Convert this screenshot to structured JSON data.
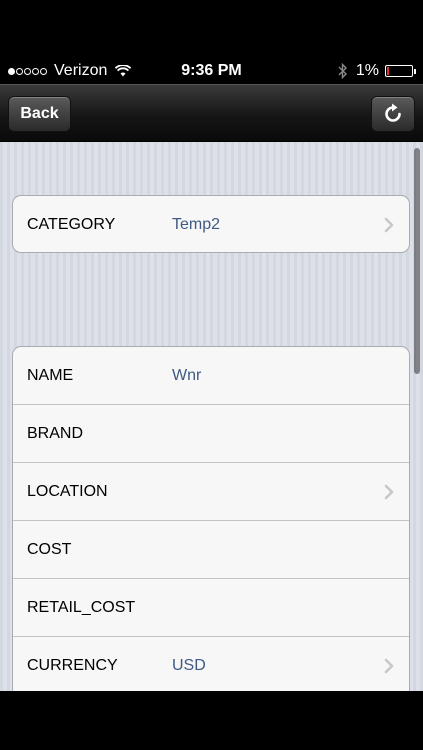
{
  "status_bar": {
    "carrier": "Verizon",
    "time": "9:36 PM",
    "battery": "1%",
    "signal_dots_filled": 1,
    "signal_dots_total": 5,
    "icons": [
      "wifi-icon",
      "bluetooth-icon",
      "battery-icon"
    ]
  },
  "nav": {
    "back_label": "Back",
    "refresh_icon": "refresh-icon"
  },
  "group1": {
    "rows": [
      {
        "label": "CATEGORY",
        "value": "Temp2",
        "disclosure": true
      }
    ]
  },
  "group2": {
    "rows": [
      {
        "label": "NAME",
        "value": "Wnr",
        "disclosure": false
      },
      {
        "label": "BRAND",
        "value": "",
        "disclosure": false
      },
      {
        "label": "LOCATION",
        "value": "",
        "disclosure": true
      },
      {
        "label": "COST",
        "value": "",
        "disclosure": false
      },
      {
        "label": "RETAIL_COST",
        "value": "",
        "disclosure": false
      },
      {
        "label": "CURRENCY",
        "value": "USD",
        "disclosure": true
      }
    ]
  },
  "colors": {
    "value_text": "#3f5a85",
    "battery_low": "#e03030"
  }
}
